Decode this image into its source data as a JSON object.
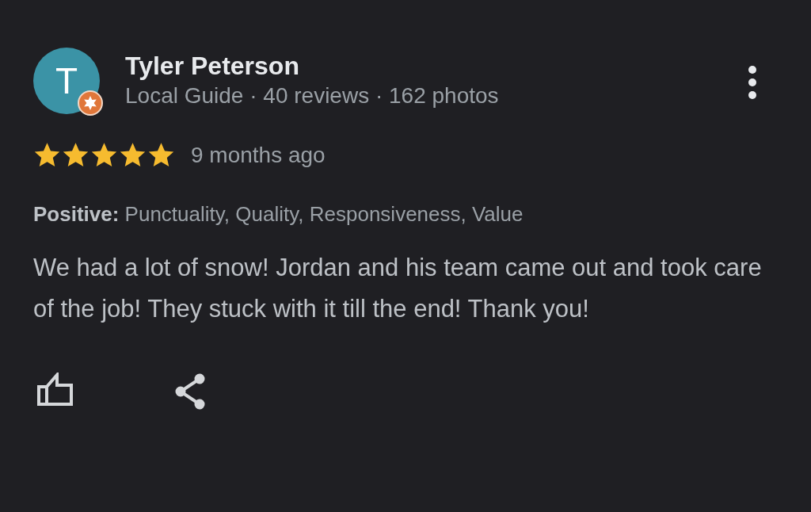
{
  "reviewer": {
    "avatar_letter": "T",
    "name": "Tyler Peterson",
    "local_guide": true,
    "meta": "Local Guide · 40 reviews · 162 photos"
  },
  "rating": {
    "stars": 5,
    "time": "9 months ago"
  },
  "attributes": {
    "label": "Positive:",
    "text": "Punctuality, Quality, Responsiveness, Value"
  },
  "review_text": "We had a lot of snow! Jordan and his team came out and took care of the job! They stuck with it till the end! Thank you!"
}
